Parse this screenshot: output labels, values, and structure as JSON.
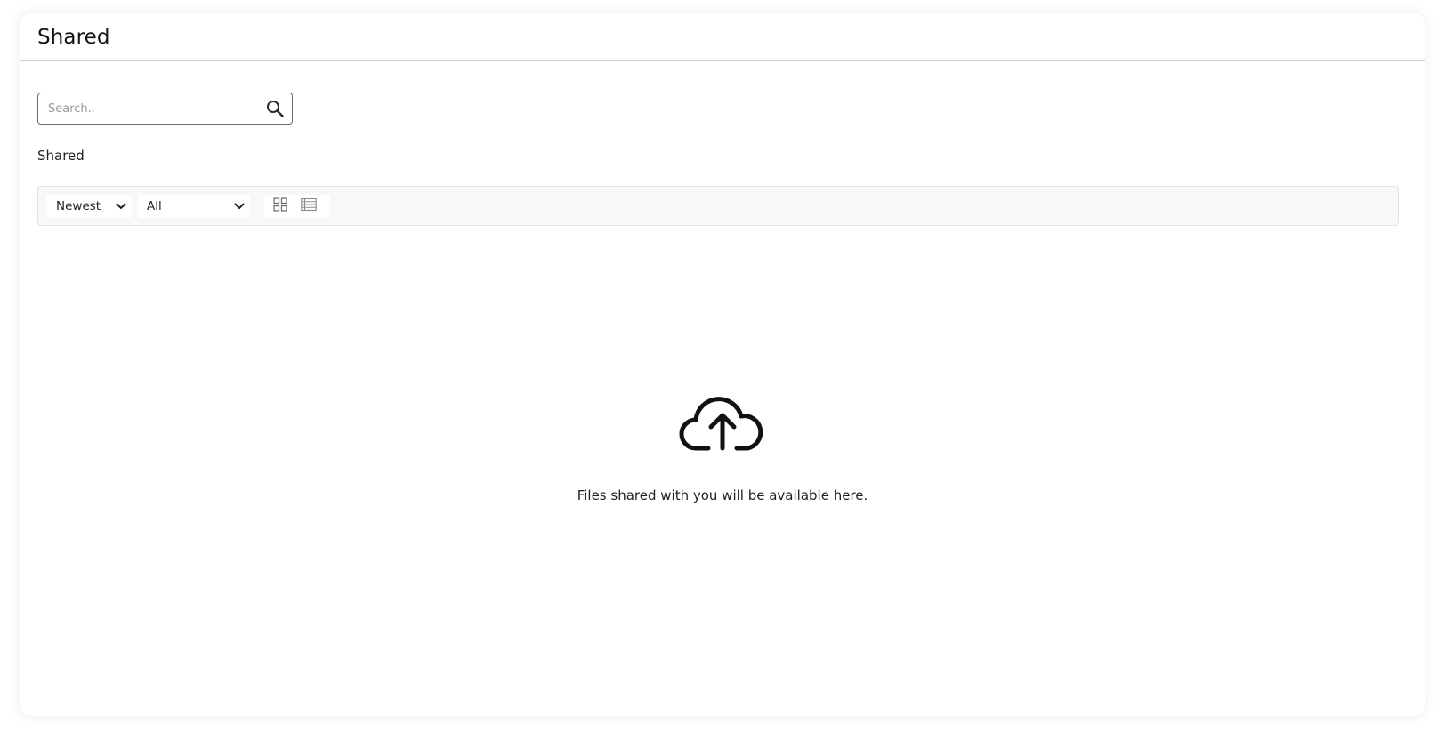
{
  "header": {
    "title": "Shared"
  },
  "search": {
    "placeholder": "Search..",
    "value": "",
    "icon": "search-icon"
  },
  "section": {
    "label": "Shared"
  },
  "toolbar": {
    "sort": {
      "selected": "Newest",
      "icon": "chevron-down-icon"
    },
    "filter": {
      "selected": "All",
      "icon": "chevron-down-icon"
    },
    "views": [
      {
        "name": "grid-view",
        "icon": "grid-icon"
      },
      {
        "name": "list-view",
        "icon": "list-icon"
      }
    ]
  },
  "empty_state": {
    "icon": "cloud-upload-icon",
    "message": "Files shared with you will be available here."
  },
  "colors": {
    "border": "#cfcfcf",
    "toolbar_bg": "#f8f8f8",
    "text": "#1f1f1f",
    "placeholder": "#9a9a9a"
  }
}
